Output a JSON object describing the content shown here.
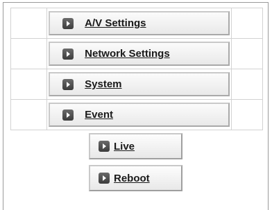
{
  "menu": {
    "items": [
      {
        "label": "A/V Settings",
        "icon": "arrow-right-icon"
      },
      {
        "label": "Network Settings",
        "icon": "arrow-right-icon"
      },
      {
        "label": "System",
        "icon": "arrow-right-icon"
      },
      {
        "label": "Event",
        "icon": "arrow-right-icon"
      }
    ]
  },
  "actions": {
    "live_label": "Live",
    "reboot_label": "Reboot"
  },
  "colors": {
    "border": "#9a9a9a",
    "cell_border": "#d2d2d2",
    "icon": "#4a4a4a",
    "text": "#1a1a1a"
  }
}
